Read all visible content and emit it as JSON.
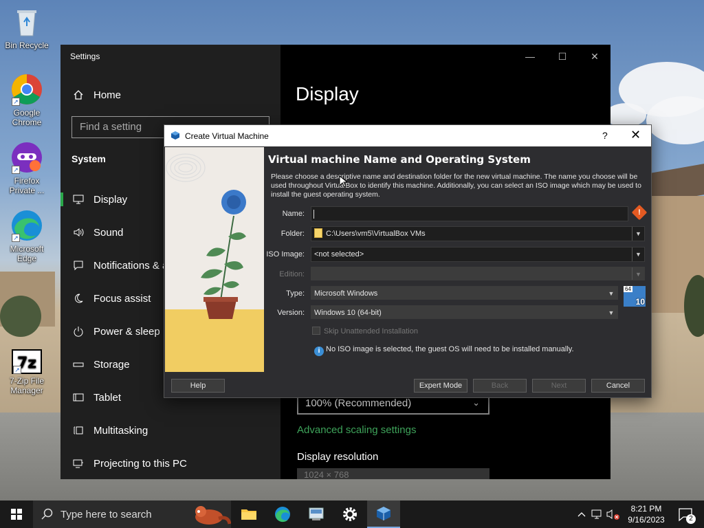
{
  "desktop": {
    "icons": [
      {
        "label": "Bin Recycle"
      },
      {
        "label": "Google Chrome"
      },
      {
        "label": "Firefox Private ..."
      },
      {
        "label": "Microsoft Edge"
      },
      {
        "label": "7-Zip File Manager"
      }
    ]
  },
  "settings": {
    "window_title": "Settings",
    "home": "Home",
    "search_placeholder": "Find a setting",
    "section": "System",
    "nav": [
      {
        "label": "Display",
        "icon": "monitor-icon"
      },
      {
        "label": "Sound",
        "icon": "speaker-icon"
      },
      {
        "label": "Notifications & a",
        "icon": "notification-icon"
      },
      {
        "label": "Focus assist",
        "icon": "moon-icon"
      },
      {
        "label": "Power & sleep",
        "icon": "power-icon"
      },
      {
        "label": "Storage",
        "icon": "storage-icon"
      },
      {
        "label": "Tablet",
        "icon": "tablet-icon"
      },
      {
        "label": "Multitasking",
        "icon": "multitasking-icon"
      },
      {
        "label": "Projecting to this PC",
        "icon": "projector-icon"
      }
    ],
    "page_title": "Display",
    "scale_value": "100% (Recommended)",
    "advanced_link": "Advanced scaling settings",
    "resolution_heading": "Display resolution",
    "resolution_value": "1024 × 768"
  },
  "vbox": {
    "title": "Create Virtual Machine",
    "help_glyph": "?",
    "close_glyph": "✕",
    "heading": "Virtual machine Name and Operating System",
    "description": "Please choose a descriptive name and destination folder for the new virtual machine. The name you choose will be used throughout VirtualBox to identify this machine. Additionally, you can select an ISO image which may be used to install the guest operating system.",
    "labels": {
      "name": "Name:",
      "folder": "Folder:",
      "iso": "ISO Image:",
      "edition": "Edition:",
      "type": "Type:",
      "version": "Version:"
    },
    "values": {
      "name": "",
      "folder": "C:\\Users\\vm5\\VirtualBox VMs",
      "iso": "<not selected>",
      "edition": "",
      "type": "Microsoft Windows",
      "version": "Windows 10 (64-bit)"
    },
    "os_badge": {
      "bits": "64",
      "version": "10"
    },
    "skip_unattended": "Skip Unattended Installation",
    "info": "No ISO image is selected, the guest OS will need to be installed manually.",
    "buttons": {
      "help": "Help",
      "expert": "Expert Mode",
      "back": "Back",
      "next": "Next",
      "cancel": "Cancel"
    }
  },
  "taskbar": {
    "search_placeholder": "Type here to search",
    "time": "8:21 PM",
    "date": "9/16/2023",
    "notification_count": "2"
  },
  "colors": {
    "accent_green": "#2ba84a",
    "link_green": "#3ea35a",
    "warning_orange": "#e45a22",
    "info_blue": "#3b8fd6"
  }
}
